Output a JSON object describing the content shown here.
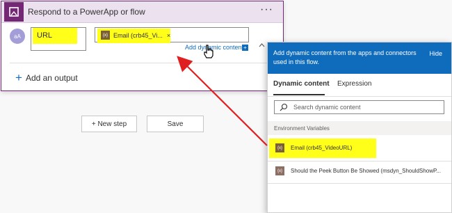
{
  "card": {
    "title": "Respond to a PowerApp or flow",
    "more_label": "···",
    "avatar_label": "aA",
    "key_value": "URL",
    "token_label": "Email (crb45_Vi...",
    "token_remove": "×",
    "add_dynamic_label": "Add dynamic content",
    "add_dynamic_plus": "+",
    "add_output_label": "Add an output"
  },
  "actions": {
    "new_step_label": "+ New step",
    "save_label": "Save"
  },
  "panel": {
    "header_text": "Add dynamic content from the apps and connectors used in this flow.",
    "hide_label": "Hide",
    "tabs": [
      {
        "label": "Dynamic content"
      },
      {
        "label": "Expression"
      }
    ],
    "search_placeholder": "Search dynamic content",
    "section_label": "Environment Variables",
    "items": [
      {
        "label": "Email (crb45_VideoURL)"
      },
      {
        "label": "Should the Peek Button Be Showed (msdyn_ShouldShowP..."
      }
    ],
    "token_icon_label": "{x}"
  },
  "colors": {
    "accent": "#742774",
    "header_bg": "#ece1ef",
    "panel_blue": "#0f6cbd",
    "highlight": "#ffff1a",
    "arrow": "#e02020"
  },
  "icons": {
    "app": "powerapps-icon",
    "search": "search-icon",
    "token": "variable-icon"
  }
}
